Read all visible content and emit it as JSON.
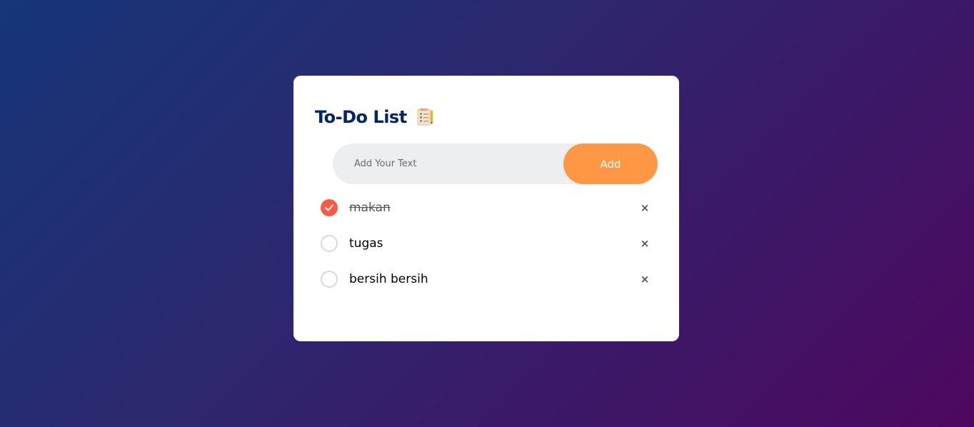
{
  "app": {
    "title": "To-Do List",
    "title_icon": "checklist-notepad-icon"
  },
  "input": {
    "placeholder": "Add Your Text",
    "value": ""
  },
  "add_button": {
    "label": "Add"
  },
  "todos": [
    {
      "text": "makan",
      "checked": true
    },
    {
      "text": "tugas",
      "checked": false
    },
    {
      "text": "bersih bersih",
      "checked": false
    }
  ],
  "icons": {
    "check": "check-icon",
    "delete": "close-icon",
    "delete_glyph": "×"
  },
  "colors": {
    "title": "#002765",
    "accent": "#ff9744",
    "checked": "#ff5945",
    "input_bg": "#edeef0",
    "background_start": "#153677",
    "background_end": "#4e085f"
  }
}
